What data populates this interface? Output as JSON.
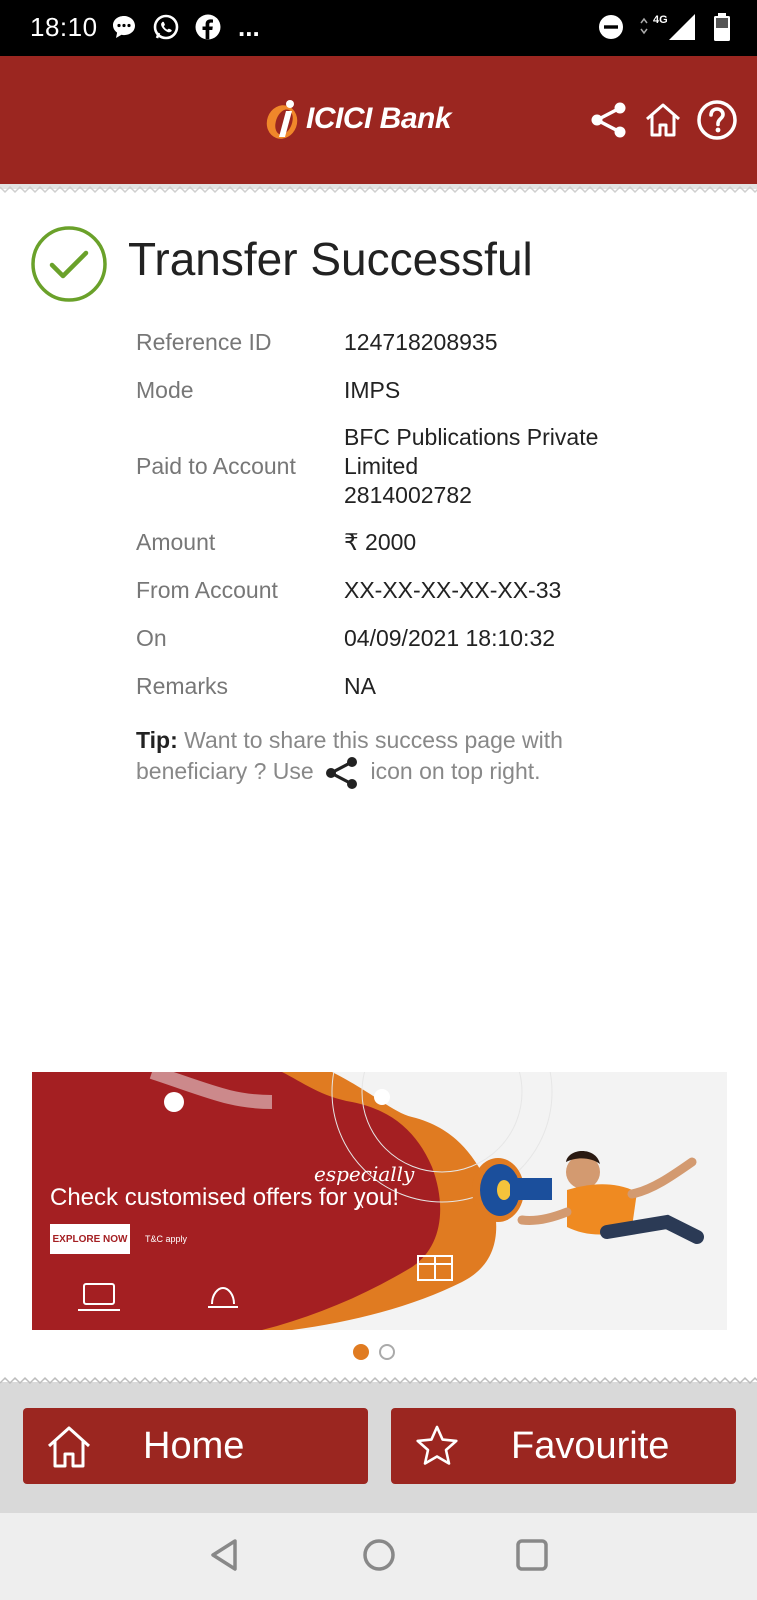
{
  "status_bar": {
    "time": "18:10",
    "network": "4G",
    "icons_left": [
      "message-icon",
      "whatsapp-icon",
      "facebook-icon"
    ],
    "more": "..."
  },
  "header": {
    "logo_text": "ICICI Bank",
    "brand_color": "#9b2620",
    "icons": [
      "share-icon",
      "home-icon",
      "help-icon"
    ]
  },
  "result": {
    "title": "Transfer Successful",
    "success_color": "#6aa12a"
  },
  "details": {
    "reference_label": "Reference ID",
    "reference_value": "124718208935",
    "mode_label": "Mode",
    "mode_value": "IMPS",
    "paid_to_label": "Paid to Account",
    "paid_to_name": "BFC Publications Private Limited",
    "paid_to_account": "2814002782",
    "amount_label": "Amount",
    "amount_value": "₹ 2000",
    "from_label": "From Account",
    "from_value": "XX-XX-XX-XX-XX-33",
    "on_label": "On",
    "on_value": "04/09/2021 18:10:32",
    "remarks_label": "Remarks",
    "remarks_value": "NA"
  },
  "tip": {
    "prefix": "Tip:",
    "text_before": "Want to share this success page with beneficiary ? Use",
    "text_after": "icon on top right."
  },
  "banner": {
    "headline": "Check customised offers for you!",
    "highlight": "especially",
    "caret": "^",
    "button": "EXPLORE NOW",
    "terms": "T&C apply",
    "accent_color": "#e07b21",
    "bg_color": "#a41f22"
  },
  "carousel": {
    "active_index": 1,
    "count": 2
  },
  "bottom_nav": {
    "home_label": "Home",
    "favourite_label": "Favourite"
  }
}
